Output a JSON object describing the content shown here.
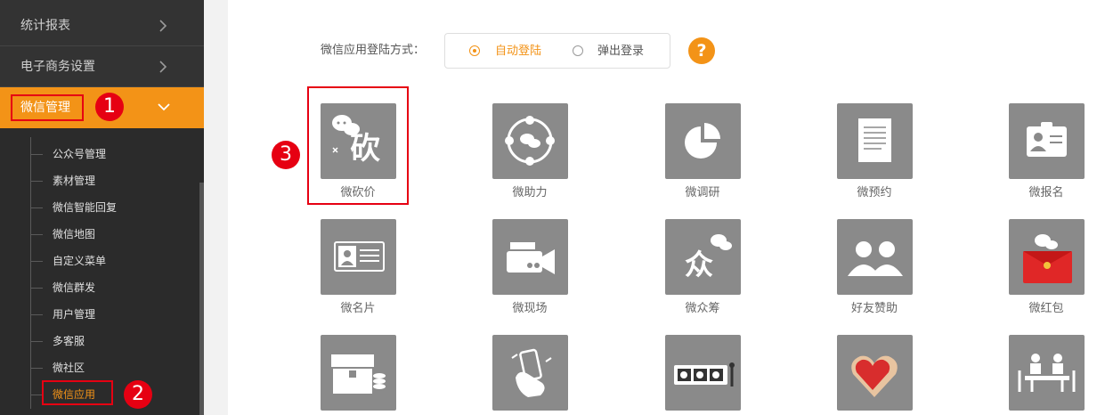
{
  "sidebar": {
    "stats_label": "统计报表",
    "ecommerce_label": "电子商务设置",
    "wechat_label": "微信管理",
    "badge1": "1",
    "badge2": "2",
    "submenu": [
      "公众号管理",
      "素材管理",
      "微信智能回复",
      "微信地图",
      "自定义菜单",
      "微信群发",
      "用户管理",
      "多客服",
      "微社区",
      "微信应用"
    ]
  },
  "login": {
    "label": "微信应用登陆方式：",
    "option_auto": "自动登陆",
    "option_popup": "弹出登录",
    "selected": "自动登陆",
    "help": "?"
  },
  "badge3": "3",
  "apps": {
    "row1": [
      "微砍价",
      "微助力",
      "微调研",
      "微预约",
      "微报名"
    ],
    "row2": [
      "微名片",
      "微现场",
      "微众筹",
      "好友赞助",
      "微红包"
    ]
  },
  "colors": {
    "accent": "#f39317",
    "sidebar": "#333333",
    "highlight": "#e60012",
    "tile": "#8a8a8a"
  }
}
